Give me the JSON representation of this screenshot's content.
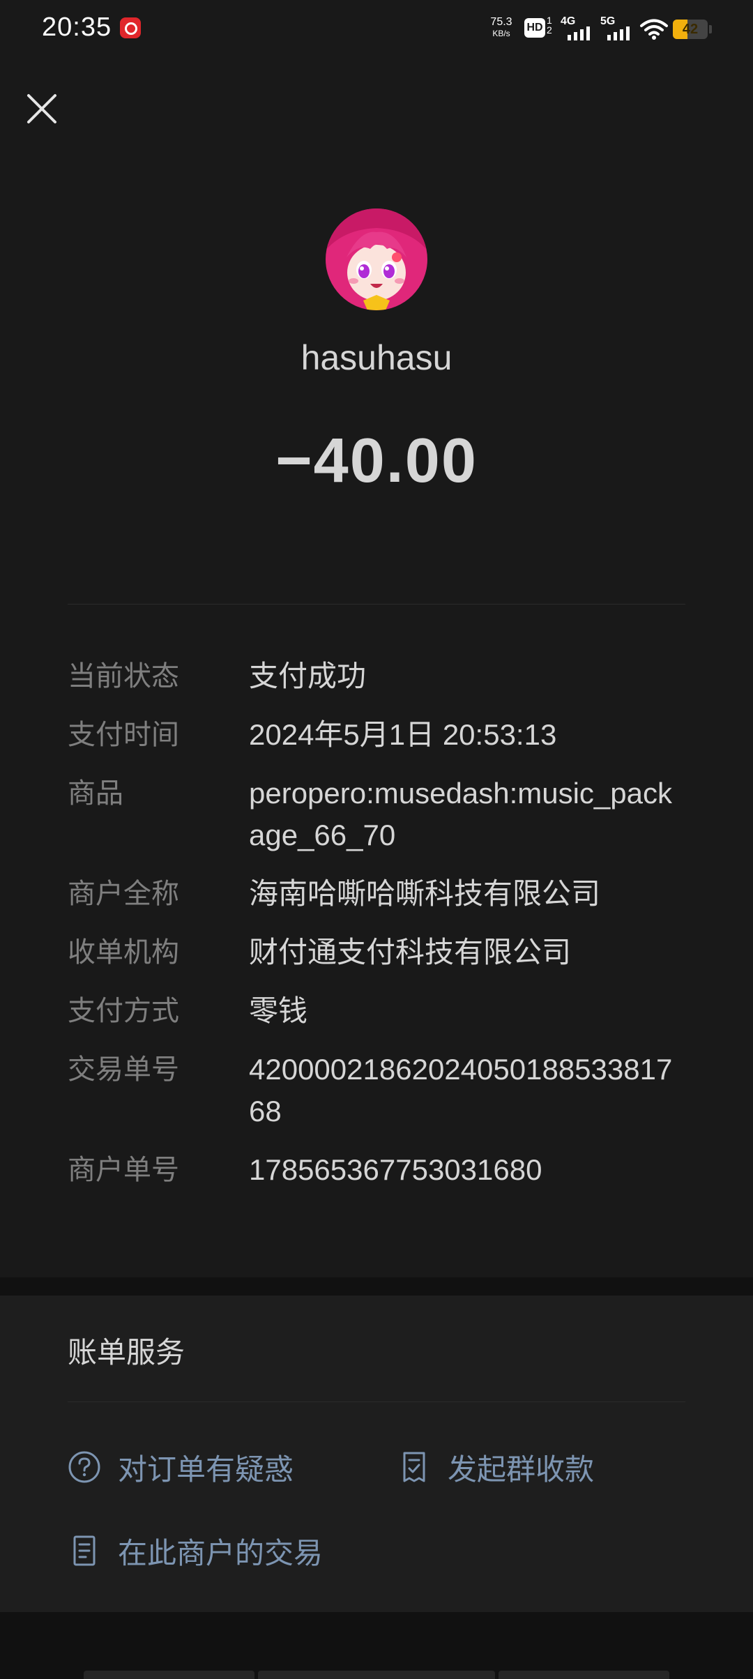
{
  "status_bar": {
    "time": "20:35",
    "net_speed_value": "75.3",
    "net_speed_unit": "KB/s",
    "hd_label": "HD",
    "hd_sub_1": "1",
    "hd_sub_2": "2",
    "sim1_gen": "4G",
    "sim2_gen": "5G",
    "battery_level": "42",
    "battery_fraction": 0.42,
    "battery_color": "#f2b00d",
    "app_icon": "netease-music-icon",
    "wifi_icon": "wifi-icon",
    "signal_icon": "signal-bars-icon"
  },
  "header": {
    "close_icon": "close-icon",
    "avatar_icon": "anime-avatar-image",
    "payee_name": "hasuhasu",
    "amount": "−40.00"
  },
  "details": [
    {
      "label": "当前状态",
      "value": "支付成功"
    },
    {
      "label": "支付时间",
      "value": "2024年5月1日 20:53:13"
    },
    {
      "label": "商品",
      "value": "peropero:musedash:music_package_66_70"
    },
    {
      "label": "商户全称",
      "value": "海南哈嘶哈嘶科技有限公司"
    },
    {
      "label": "收单机构",
      "value": "财付通支付科技有限公司"
    },
    {
      "label": "支付方式",
      "value": "零钱"
    },
    {
      "label": "交易单号",
      "value": "4200002186202405018853381768"
    },
    {
      "label": "商户单号",
      "value": "178565367753031680"
    }
  ],
  "services": {
    "title": "账单服务",
    "link_color": "#7d95b2",
    "actions": [
      {
        "label": "对订单有疑惑",
        "icon": "question-circle-icon"
      },
      {
        "label": "发起群收款",
        "icon": "checklist-document-icon"
      },
      {
        "label": "在此商户的交易",
        "icon": "document-list-icon"
      }
    ]
  },
  "colors": {
    "background": "#191919",
    "card": "#1e1e1e",
    "text_primary": "#d6d6d6",
    "text_secondary": "#7f7f7f"
  }
}
